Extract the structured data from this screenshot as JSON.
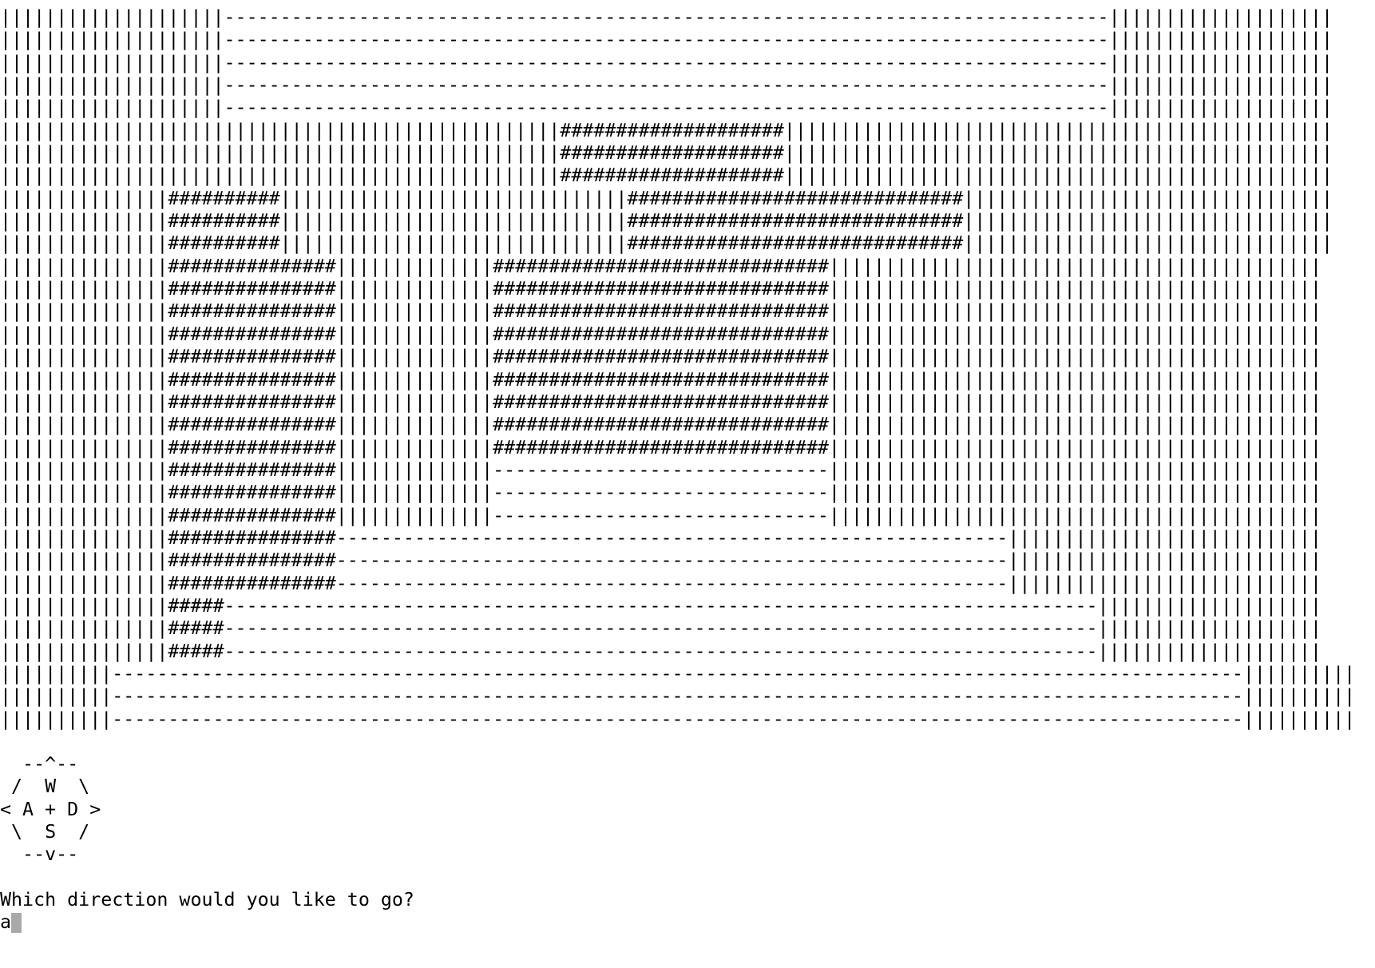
{
  "maze": {
    "lines": [
      "||||||||||||||||||||-------------------------------------------------------------------------------||||||||||||||||||||",
      "||||||||||||||||||||-------------------------------------------------------------------------------||||||||||||||||||||",
      "||||||||||||||||||||-------------------------------------------------------------------------------||||||||||||||||||||",
      "||||||||||||||||||||-------------------------------------------------------------------------------||||||||||||||||||||",
      "||||||||||||||||||||-------------------------------------------------------------------------------||||||||||||||||||||",
      "||||||||||||||||||||||||||||||||||||||||||||||||||####################|||||||||||||||||||||||||||||||||||||||||||||||||",
      "||||||||||||||||||||||||||||||||||||||||||||||||||####################|||||||||||||||||||||||||||||||||||||||||||||||||",
      "||||||||||||||||||||||||||||||||||||||||||||||||||####################|||||||||||||||||||||||||||||||||||||||||||||||||",
      "|||||||||||||||##########|||||||||||||||||||||||||||||||##############################|||||||||||||||||||||||||||||||||",
      "|||||||||||||||##########|||||||||||||||||||||||||||||||##############################|||||||||||||||||||||||||||||||||",
      "|||||||||||||||##########|||||||||||||||||||||||||||||||##############################|||||||||||||||||||||||||||||||||",
      "|||||||||||||||###############||||||||||||||##############################||||||||||||||||||||||||||||||||||||||||||||",
      "|||||||||||||||###############||||||||||||||##############################||||||||||||||||||||||||||||||||||||||||||||",
      "|||||||||||||||###############||||||||||||||##############################||||||||||||||||||||||||||||||||||||||||||||",
      "|||||||||||||||###############||||||||||||||##############################||||||||||||||||||||||||||||||||||||||||||||",
      "|||||||||||||||###############||||||||||||||##############################||||||||||||||||||||||||||||||||||||||||||||",
      "|||||||||||||||###############||||||||||||||##############################||||||||||||||||||||||||||||||||||||||||||||",
      "|||||||||||||||###############||||||||||||||##############################||||||||||||||||||||||||||||||||||||||||||||",
      "|||||||||||||||###############||||||||||||||##############################||||||||||||||||||||||||||||||||||||||||||||",
      "|||||||||||||||###############||||||||||||||##############################||||||||||||||||||||||||||||||||||||||||||||",
      "|||||||||||||||###############||||||||||||||------------------------------||||||||||||||||||||||||||||||||||||||||||||",
      "|||||||||||||||###############||||||||||||||------------------------------||||||||||||||||||||||||||||||||||||||||||||",
      "|||||||||||||||###############||||||||||||||------------------------------||||||||||||||||||||||||||||||||||||||||||||",
      "|||||||||||||||###############------------------------------------------------------------||||||||||||||||||||||||||||",
      "|||||||||||||||###############------------------------------------------------------------||||||||||||||||||||||||||||",
      "|||||||||||||||###############------------------------------------------------------------||||||||||||||||||||||||||||",
      "|||||||||||||||#####------------------------------------------------------------------------------||||||||||||||||||||",
      "|||||||||||||||#####------------------------------------------------------------------------------||||||||||||||||||||",
      "|||||||||||||||#####------------------------------------------------------------------------------||||||||||||||||||||",
      "||||||||||-----------------------------------------------------------------------------------------------------||||||||||",
      "||||||||||-----------------------------------------------------------------------------------------------------||||||||||",
      "||||||||||-----------------------------------------------------------------------------------------------------||||||||||"
    ]
  },
  "controls": {
    "lines": [
      "  --^--",
      " /  W  \\",
      "< A + D >",
      " \\  S  /",
      "  --v--"
    ]
  },
  "prompt": {
    "question": "Which direction would you like to go?",
    "input_value": "a"
  }
}
